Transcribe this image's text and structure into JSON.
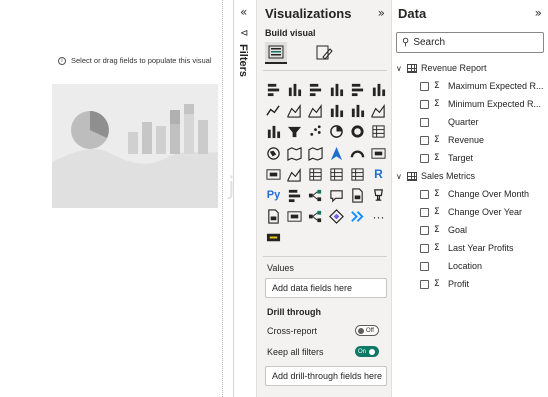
{
  "canvas": {
    "hint": "Select or drag fields to populate this visual",
    "watermark": "java"
  },
  "filters": {
    "label": "Filters",
    "expand_icon": "chevron-double-left",
    "filter_icon": "funnel"
  },
  "visualizations": {
    "title": "Visualizations",
    "collapse_icon": "chevron-double-right",
    "build_visual": "Build visual",
    "modes": [
      "build-visual-icon",
      "format-visual-icon"
    ],
    "icons": [
      "stacked-bar-chart-icon",
      "stacked-column-chart-icon",
      "clustered-bar-chart-icon",
      "clustered-column-chart-icon",
      "100-stacked-bar-chart-icon",
      "100-stacked-column-chart-icon",
      "line-chart-icon",
      "area-chart-icon",
      "stacked-area-chart-icon",
      "line-stacked-column-icon",
      "line-clustered-column-icon",
      "ribbon-chart-icon",
      "waterfall-chart-icon",
      "funnel-chart-icon",
      "scatter-chart-icon",
      "pie-chart-icon",
      "donut-chart-icon",
      "treemap-icon",
      "map-icon",
      "filled-map-icon",
      "shape-map-icon",
      "azure-map-icon",
      "gauge-icon",
      "card-icon",
      "multi-row-card-icon",
      "kpi-icon",
      "slicer-icon",
      "table-icon",
      "matrix-icon",
      "r-visual-icon",
      "python-visual-icon",
      "key-influencers-icon",
      "decomposition-tree-icon",
      "qna-icon",
      "smart-narrative-icon",
      "goals-icon",
      "paginated-report-icon",
      "power-apps-icon",
      "power-automate-icon",
      "arcgis-icon",
      "power-automate-flow-icon",
      "more-visuals-icon",
      "custom-visual-icon"
    ],
    "r_label": "R",
    "py_label": "Py",
    "more_label": "···",
    "values_label": "Values",
    "values_placeholder": "Add data fields here",
    "drill_through": "Drill through",
    "cross_report": "Cross-report",
    "cross_report_state": "Off",
    "keep_all_filters": "Keep all filters",
    "keep_all_filters_state": "On",
    "drill_placeholder": "Add drill-through fields here"
  },
  "data": {
    "title": "Data",
    "collapse_icon": "chevron-double-right",
    "search_placeholder": "Search",
    "tables": [
      {
        "name": "Revenue Report",
        "fields": [
          {
            "name": "Maximum Expected R...",
            "sigma": true
          },
          {
            "name": "Minimum Expected R...",
            "sigma": true
          },
          {
            "name": "Quarter",
            "sigma": false
          },
          {
            "name": "Revenue",
            "sigma": true
          },
          {
            "name": "Target",
            "sigma": true
          }
        ]
      },
      {
        "name": "Sales Metrics",
        "fields": [
          {
            "name": "Change Over Month",
            "sigma": true
          },
          {
            "name": "Change Over Year",
            "sigma": true
          },
          {
            "name": "Goal",
            "sigma": true
          },
          {
            "name": "Last Year Profits",
            "sigma": true
          },
          {
            "name": "Location",
            "sigma": false
          },
          {
            "name": "Profit",
            "sigma": true
          }
        ]
      }
    ]
  },
  "colors": {
    "pane_bg": "#f3f2f1",
    "toggle_on": "#117865",
    "placeholder_gray": "#d9d9d9"
  }
}
